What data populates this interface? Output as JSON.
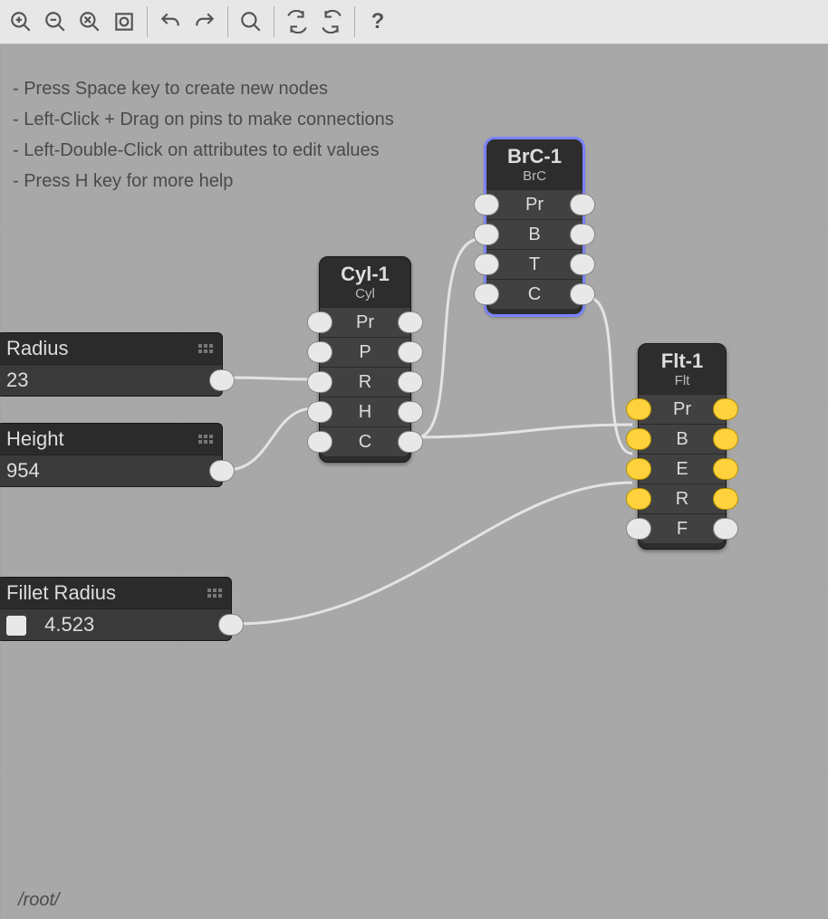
{
  "toolbar": {
    "zoom_in": "zoom-in",
    "zoom_out": "zoom-out",
    "zoom_reset": "zoom-reset",
    "zoom_fit": "zoom-fit",
    "undo": "undo",
    "redo": "redo",
    "search": "search",
    "refresh_down": "refresh-down",
    "refresh_up": "refresh-up",
    "help": "?"
  },
  "help_lines": [
    "Press Space key to create new nodes",
    "Left-Click + Drag on pins to make connections",
    "Left-Double-Click on attributes to edit values",
    "Press H key for more help"
  ],
  "path_label": "/root/",
  "params": {
    "radius": {
      "label": "Radius",
      "value": "23"
    },
    "height": {
      "label": "Height",
      "value": "954"
    },
    "fillet": {
      "label": "Fillet Radius",
      "value": "4.523"
    }
  },
  "nodes": {
    "cyl": {
      "title": "Cyl-1",
      "subtitle": "Cyl",
      "rows": [
        "Pr",
        "P",
        "R",
        "H",
        "C"
      ]
    },
    "brc": {
      "title": "BrC-1",
      "subtitle": "BrC",
      "rows": [
        "Pr",
        "B",
        "T",
        "C"
      ],
      "selected": true
    },
    "flt": {
      "title": "Flt-1",
      "subtitle": "Flt",
      "rows": [
        "Pr",
        "B",
        "E",
        "R",
        "F"
      ]
    }
  }
}
